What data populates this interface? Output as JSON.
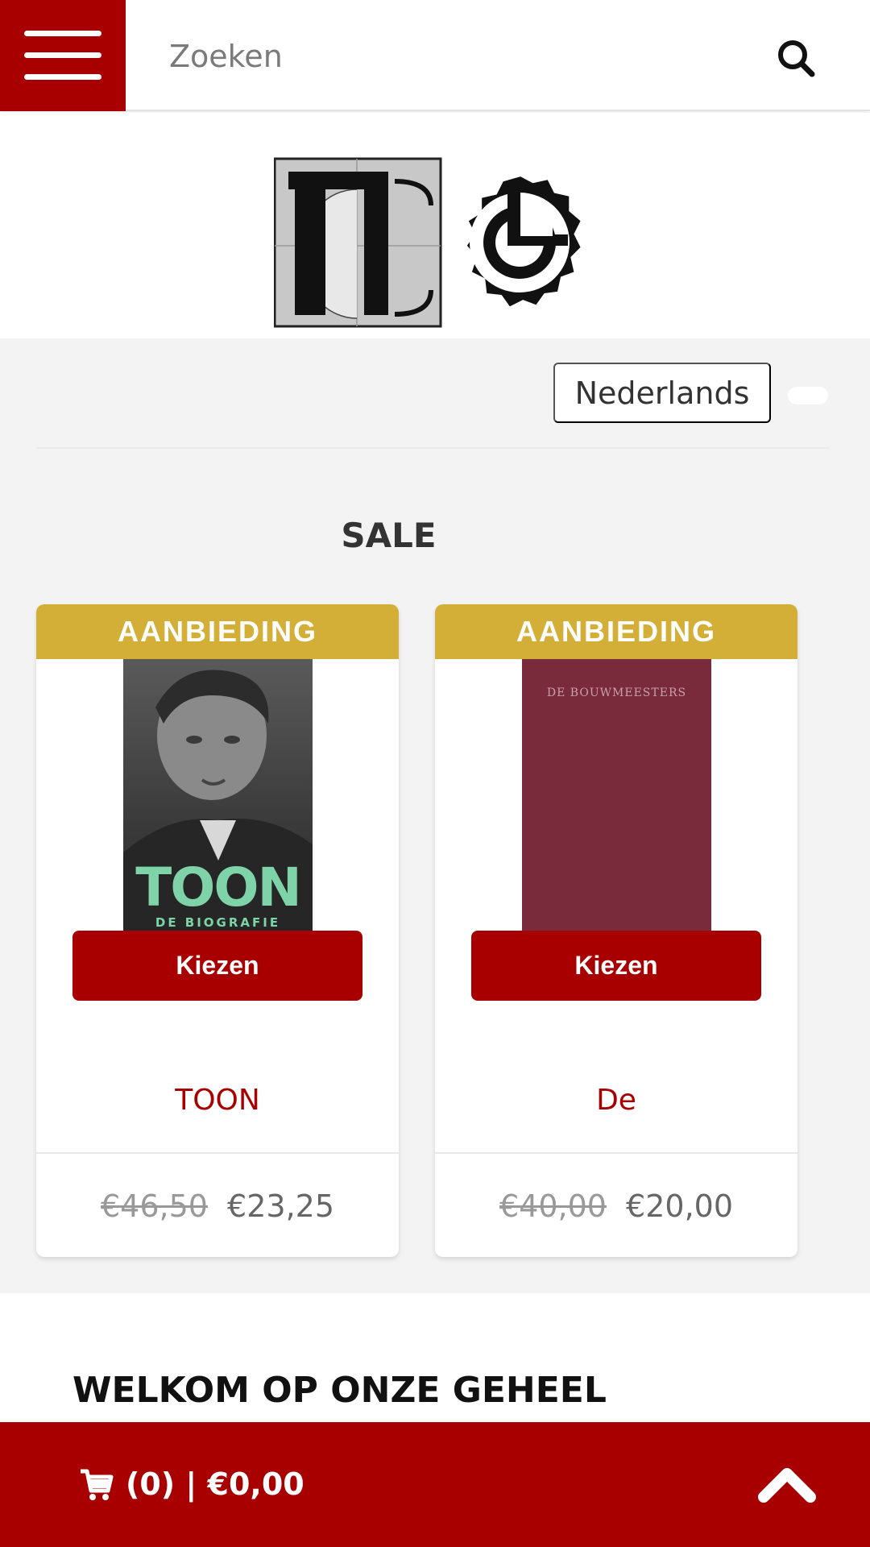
{
  "header": {
    "search_placeholder": "Zoeken"
  },
  "language": {
    "selected": "Nederlands"
  },
  "sale": {
    "title": "SALE",
    "products": [
      {
        "badge": "AANBIEDING",
        "cover_text": "TOON",
        "cover_subtext": "DE BIOGRAFIE",
        "button_label": "Kiezen",
        "title": "TOON",
        "old_price": "€46,50",
        "price": "€23,25"
      },
      {
        "badge": "AANBIEDING",
        "cover_text": "DE BOUWMEESTERS",
        "button_label": "Kiezen",
        "title": "De",
        "old_price": "€40,00",
        "price": "€20,00"
      }
    ]
  },
  "welcome": {
    "heading": "WELKOM OP ONZE GEHEEL"
  },
  "footer": {
    "cart_label": "(0) | €0,00"
  },
  "colors": {
    "brand": "#a80000",
    "sale_badge": "#d4af37",
    "background_gray": "#f3f3f3",
    "cover_bouwmeesters": "#7a2b3b",
    "cover_toon_title": "#7fd3a8"
  },
  "icons": {
    "menu": "hamburger-menu-icon",
    "search": "search-icon",
    "cart": "cart-icon",
    "scroll_top": "chevron-up-icon"
  }
}
